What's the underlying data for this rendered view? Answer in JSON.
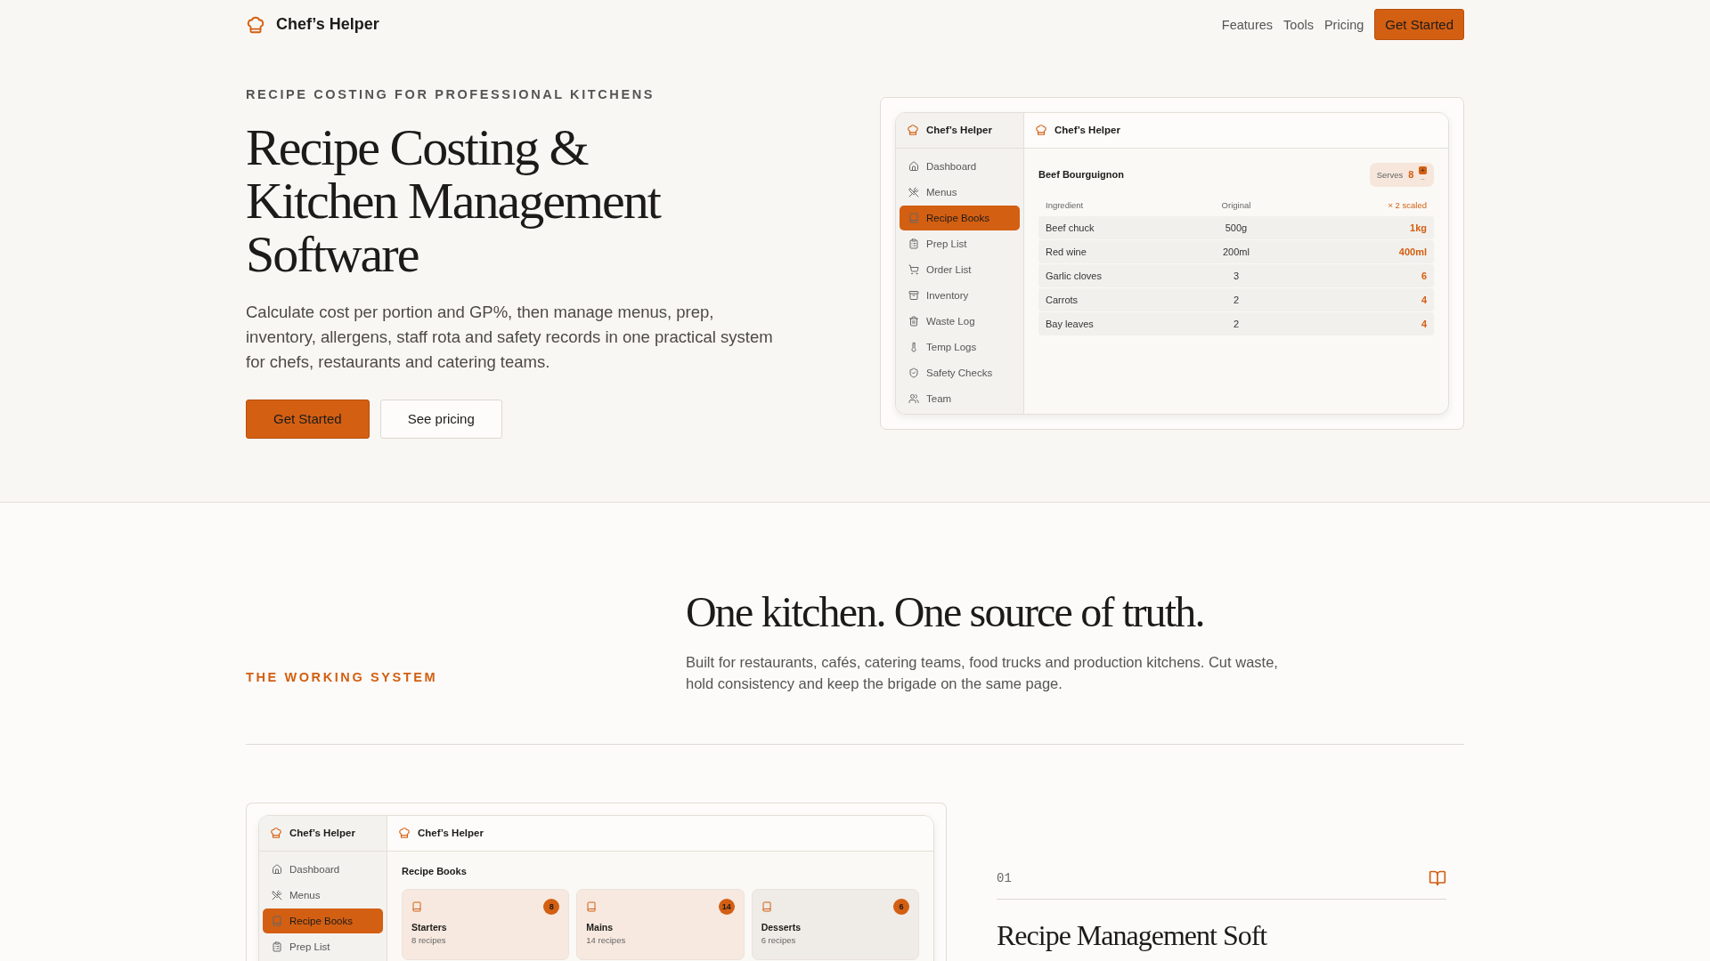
{
  "nav": {
    "brand": "Chef’s Helper",
    "links": [
      "Features",
      "Tools",
      "Pricing"
    ],
    "cta": "Get Started"
  },
  "hero": {
    "eyebrow": "RECIPE COSTING FOR PROFESSIONAL KITCHENS",
    "title": "Recipe Costing & Kitchen Management Software",
    "lead": "Calculate cost per portion and GP%, then manage menus, prep, inventory, allergens, staff rota and safety records in one practical system for chefs, restaurants and catering teams.",
    "primary": "Get Started",
    "secondary": "See pricing"
  },
  "hero_app": {
    "brand": "Chef’s Helper",
    "header_brand": "Chef’s Helper",
    "sidebar": [
      {
        "label": "Dashboard",
        "selected": false
      },
      {
        "label": "Menus",
        "selected": false
      },
      {
        "label": "Recipe Books",
        "selected": true
      },
      {
        "label": "Prep List",
        "selected": false
      },
      {
        "label": "Order List",
        "selected": false
      },
      {
        "label": "Inventory",
        "selected": false
      },
      {
        "label": "Waste Log",
        "selected": false
      },
      {
        "label": "Temp Logs",
        "selected": false
      },
      {
        "label": "Safety Checks",
        "selected": false
      },
      {
        "label": "Team",
        "selected": false
      }
    ],
    "recipe": "Beef Bourguignon",
    "serves_label": "Serves",
    "serves": "8",
    "plus": "+",
    "minus": "−",
    "columns": [
      "Ingredient",
      "Original",
      "× 2 scaled"
    ],
    "rows": [
      [
        "Beef chuck",
        "500g",
        "1kg"
      ],
      [
        "Red wine",
        "200ml",
        "400ml"
      ],
      [
        "Garlic cloves",
        "3",
        "6"
      ],
      [
        "Carrots",
        "2",
        "4"
      ],
      [
        "Bay leaves",
        "2",
        "4"
      ]
    ]
  },
  "system": {
    "eyebrow": "THE WORKING SYSTEM",
    "title": "One kitchen. One source of truth.",
    "text": "Built for restaurants, cafés, catering teams, food trucks and production kitchens. Cut waste, hold consistency and keep the brigade on the same page."
  },
  "books_app": {
    "brand": "Chef’s Helper",
    "header_brand": "Chef’s Helper",
    "sidebar": [
      {
        "label": "Dashboard",
        "selected": false
      },
      {
        "label": "Menus",
        "selected": false
      },
      {
        "label": "Recipe Books",
        "selected": true
      },
      {
        "label": "Prep List",
        "selected": false
      }
    ],
    "title": "Recipe Books",
    "books": [
      {
        "name": "Starters",
        "count": "8",
        "sub": "8 recipes",
        "color": "#f7e9e0"
      },
      {
        "name": "Mains",
        "count": "14",
        "sub": "14 recipes",
        "color": "#f7e9e0"
      },
      {
        "name": "Desserts",
        "count": "6",
        "sub": "6 recipes",
        "color": "#efebe6"
      }
    ]
  },
  "feature": {
    "number": "01",
    "title": "Recipe Management Soft"
  }
}
